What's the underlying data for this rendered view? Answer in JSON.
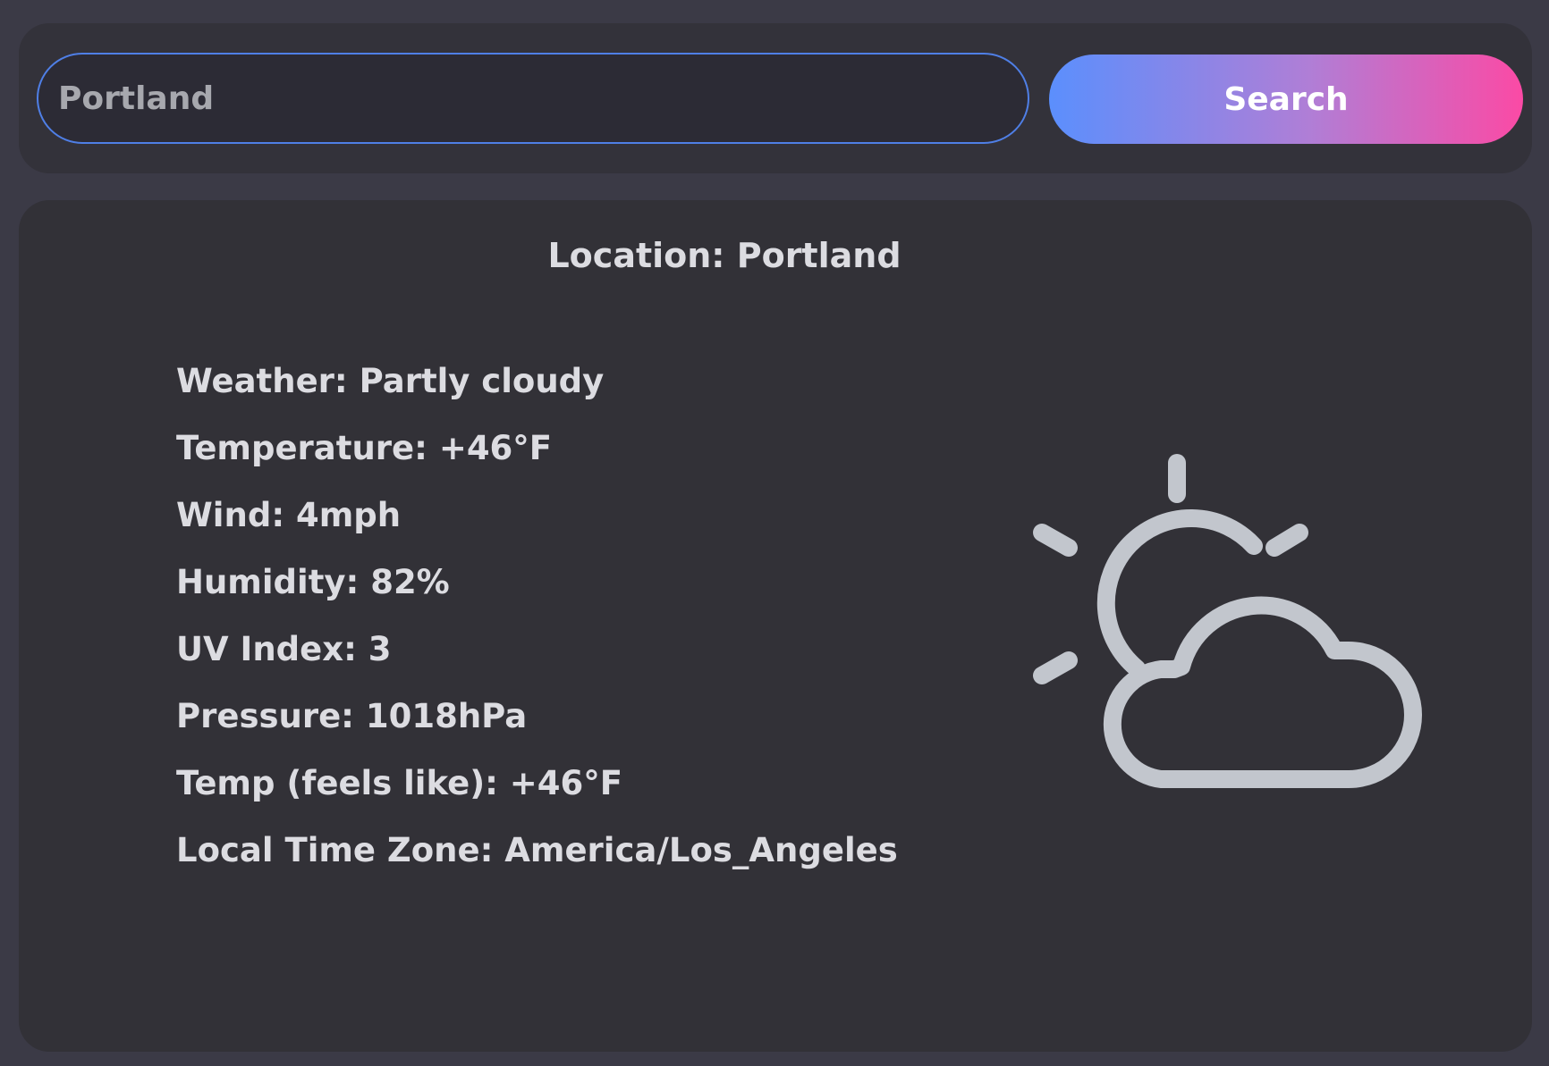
{
  "search": {
    "value": "Portland",
    "button_label": "Search"
  },
  "weather": {
    "location": "Location: Portland",
    "details": [
      "Weather: Partly cloudy",
      "Temperature: +46°F",
      "Wind: 4mph",
      "Humidity: 82%",
      "UV Index: 3",
      "Pressure: 1018hPa",
      "Temp (feels like): +46°F",
      "Local Time Zone: America/Los_Angeles"
    ],
    "icon": "partly-cloudy-icon"
  },
  "colors": {
    "page_background": "#3b3a46",
    "panel_background": "#33323a",
    "card_background": "#323137",
    "input_border": "#4f7fe6",
    "button_gradient_start": "#5b8ffd",
    "button_gradient_end": "#fb4aa5",
    "text": "#dcdce1",
    "icon": "#c2c6cd"
  }
}
